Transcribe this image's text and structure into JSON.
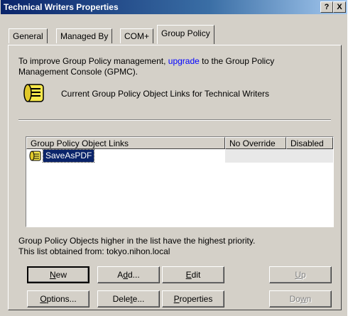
{
  "window": {
    "title": "Technical Writers Properties",
    "help_label": "?",
    "close_label": "X"
  },
  "tabs": [
    {
      "label": "General"
    },
    {
      "label": "Managed By"
    },
    {
      "label": "COM+"
    },
    {
      "label": "Group Policy",
      "active": true
    }
  ],
  "panel": {
    "intro_before_link": "To improve Group Policy management,",
    "link": "upgrade",
    "intro_after_link": "to the Group Policy",
    "intro_line2": "Management Console (GPMC).",
    "heading": "Current Group Policy Object Links for Technical Writers",
    "heading_icon": "gpo-scroll-icon"
  },
  "list": {
    "columns": [
      "Group Policy Object Links",
      "No Override",
      "Disabled"
    ],
    "rows": [
      {
        "name": "SaveAsPDF",
        "icon": "gpo-scroll-icon",
        "no_override": "",
        "disabled": ""
      }
    ]
  },
  "footer": {
    "line1": "Group Policy Objects higher in the list have the highest priority.",
    "line2": "This list obtained from: tokyo.nihon.local"
  },
  "buttons": {
    "new_pre": "",
    "new_key": "N",
    "new_post": "ew",
    "add_pre": "A",
    "add_key": "d",
    "add_post": "d...",
    "edit_pre": "",
    "edit_key": "E",
    "edit_post": "dit",
    "up_pre": "",
    "up_key": "U",
    "up_post": "p",
    "options_pre": "",
    "options_key": "O",
    "options_post": "ptions...",
    "delete_pre": "Dele",
    "delete_key": "t",
    "delete_post": "e...",
    "properties_pre": "",
    "properties_key": "P",
    "properties_post": "roperties",
    "down_pre": "Do",
    "down_key": "w",
    "down_post": "n"
  }
}
